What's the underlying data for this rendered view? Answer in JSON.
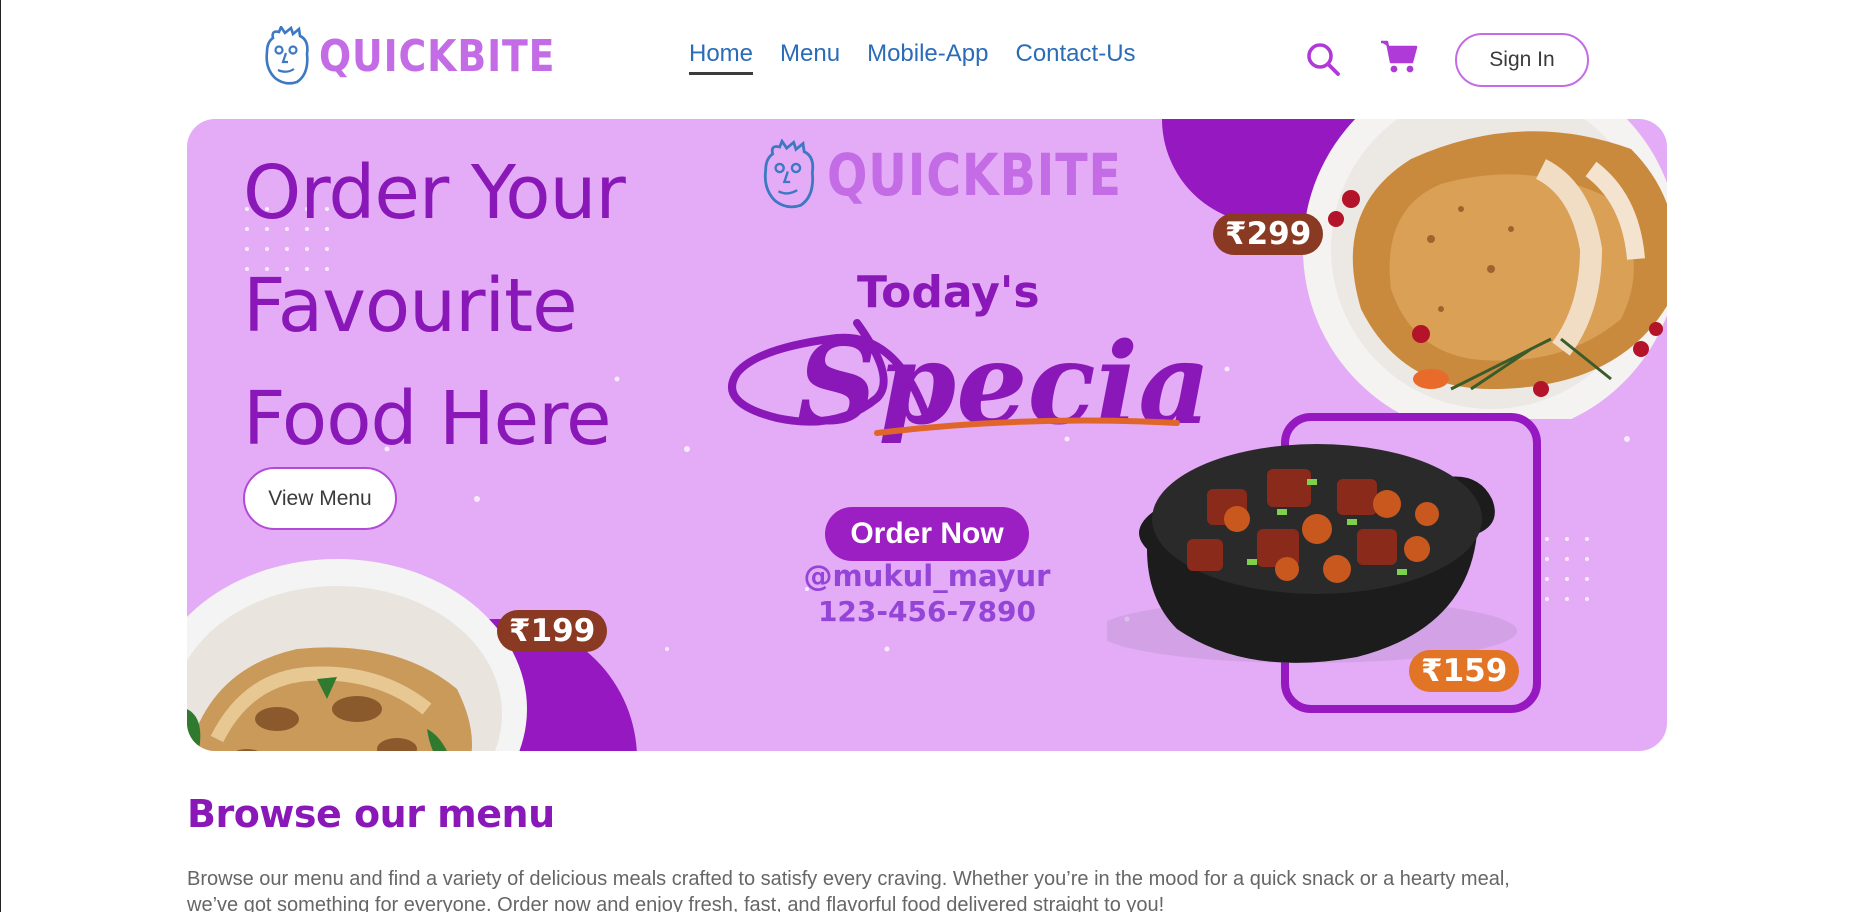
{
  "navbar": {
    "logo_text": "QUICKBITE",
    "links": [
      {
        "label": "Home",
        "active": true
      },
      {
        "label": "Menu",
        "active": false
      },
      {
        "label": "Mobile-App",
        "active": false
      },
      {
        "label": "Contact-Us",
        "active": false
      }
    ],
    "search_icon": "search-icon",
    "cart_icon": "cart-icon",
    "signin_label": "Sign In"
  },
  "hero": {
    "heading_lines": [
      "Order Your",
      "Favourite",
      "Food Here"
    ],
    "view_menu_label": "View Menu",
    "banner": {
      "logo_text": "QUICKBITE",
      "todays": "Today's",
      "special": "Special",
      "order_now": "Order Now",
      "handle": "@mukul_mayur",
      "phone": "123-456-7890",
      "prices": {
        "roast": "₹299",
        "noodles": "₹199",
        "stew": "₹159"
      }
    }
  },
  "browse": {
    "title": "Browse our menu",
    "description": "Browse our menu and find a variety of delicious meals crafted to satisfy every craving. Whether you’re in the mood for a quick snack or a hearty meal, we’ve got something for everyone. Order now and enjoy fresh, fast, and flavorful food delivered straight to you!"
  },
  "colors": {
    "brand_purple": "#8a18b8",
    "logo_purple": "#c46be6",
    "hero_bg": "#e4acf6",
    "nav_blue": "#2b6cb8"
  }
}
